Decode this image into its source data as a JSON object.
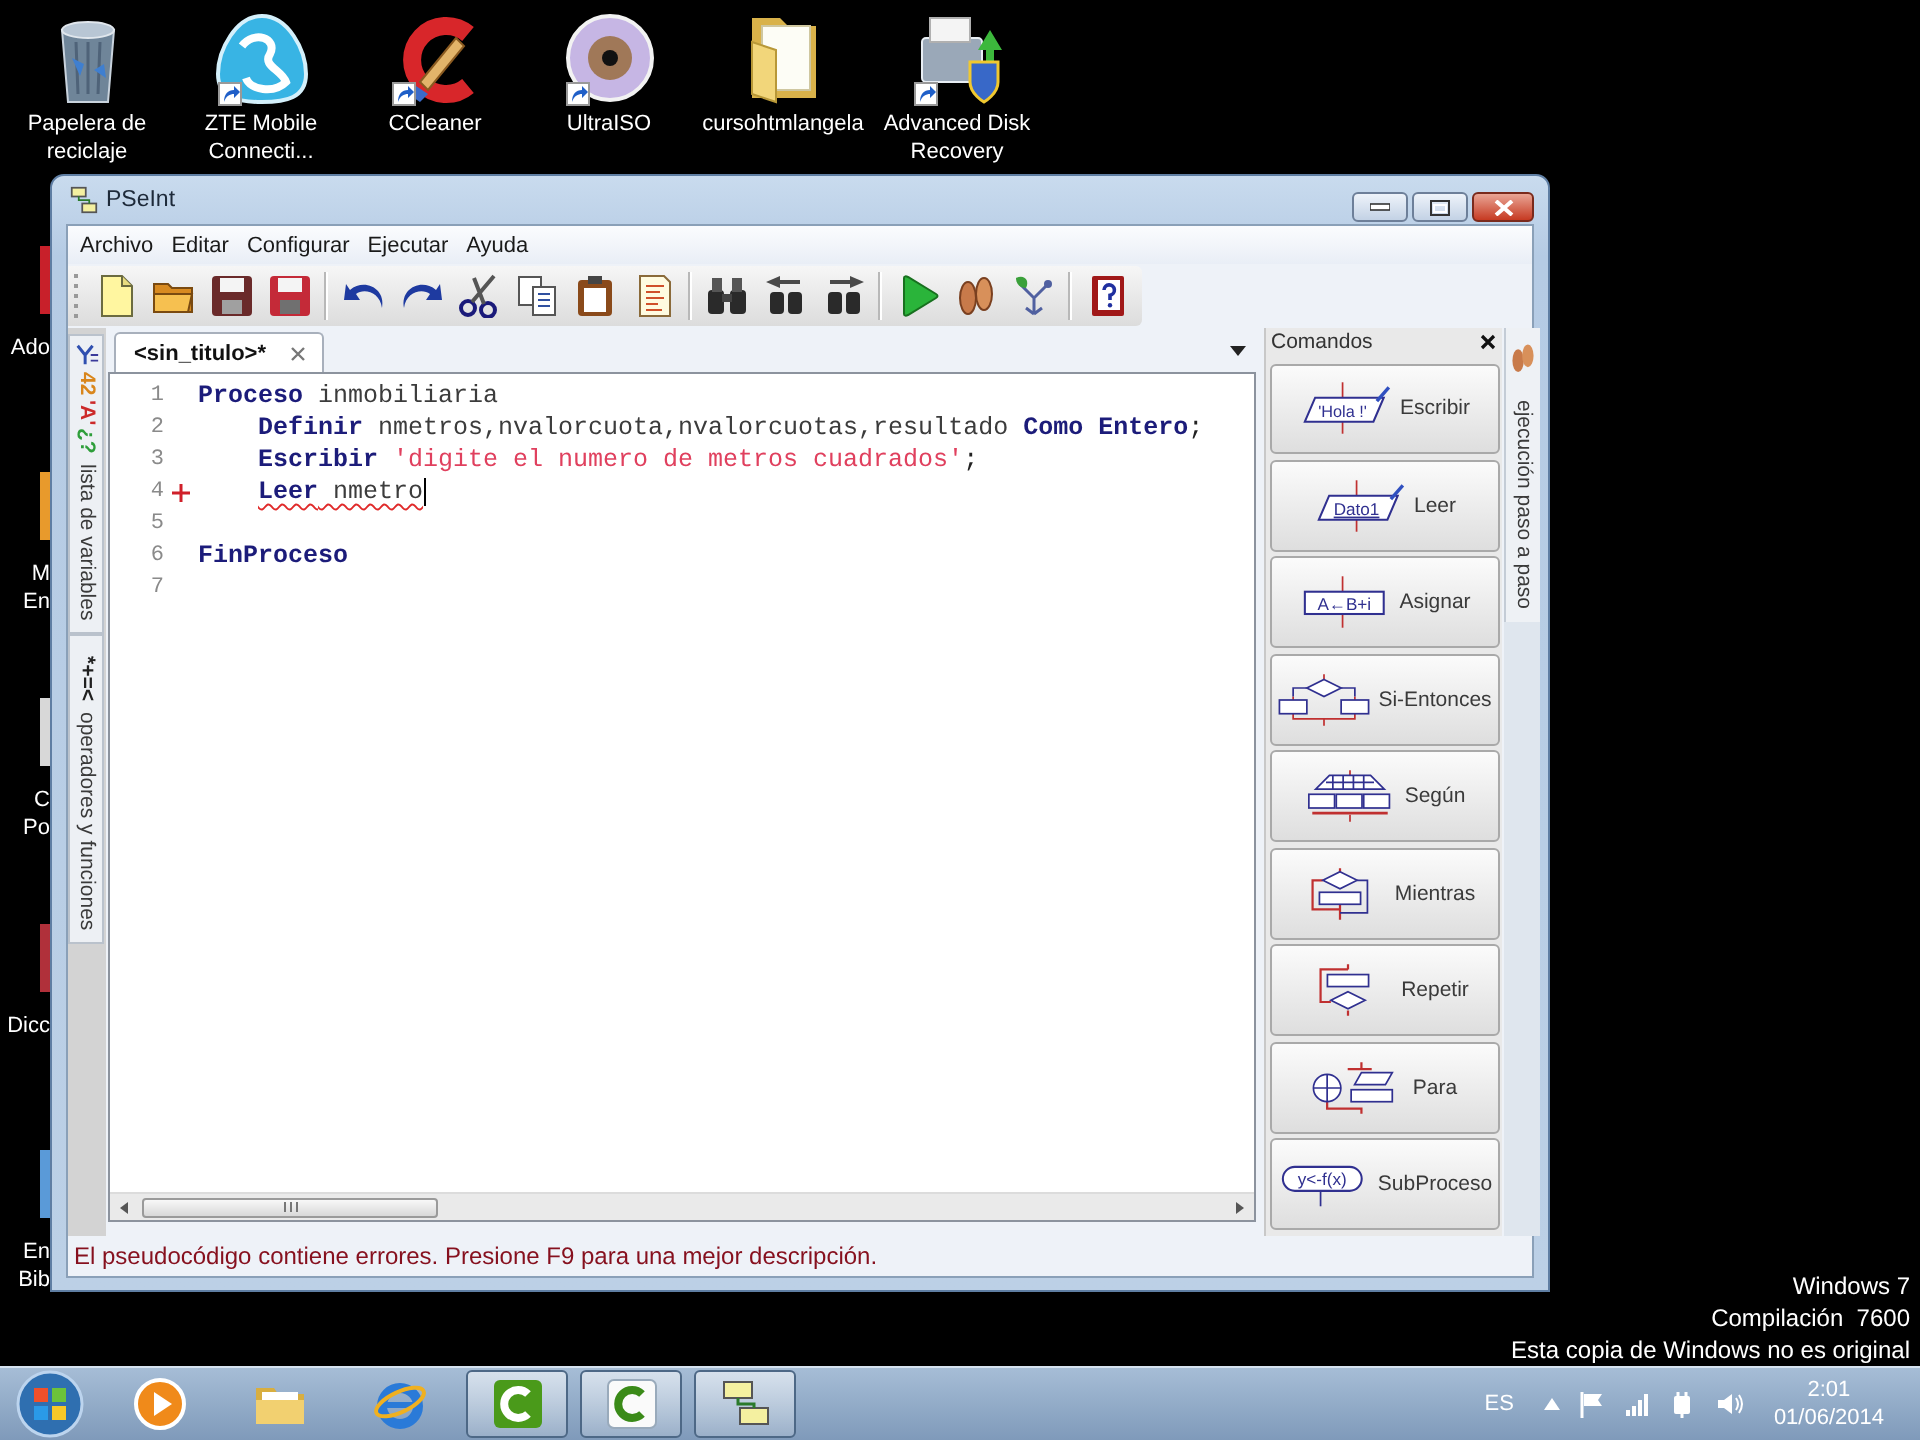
{
  "desktop_icons": [
    {
      "label": "Papelera de reciclaje",
      "shortcut": false
    },
    {
      "label": "ZTE Mobile Connecti...",
      "shortcut": true
    },
    {
      "label": "CCleaner",
      "shortcut": true
    },
    {
      "label": "UltraISO",
      "shortcut": true
    },
    {
      "label": "cursohtmlangela",
      "shortcut": false
    },
    {
      "label": "Advanced Disk Recovery",
      "shortcut": true
    }
  ],
  "desktop_edge_icons": [
    {
      "lines": [
        "Ado"
      ]
    },
    {
      "lines": [
        "M",
        "En"
      ]
    },
    {
      "lines": [
        "C",
        "Po"
      ]
    },
    {
      "lines": [
        "Dicc"
      ]
    },
    {
      "lines": [
        "En",
        "Bib"
      ]
    }
  ],
  "window": {
    "title": "PSeInt",
    "menu": [
      "Archivo",
      "Editar",
      "Configurar",
      "Ejecutar",
      "Ayuda"
    ],
    "side_tabs": [
      {
        "kind": "variables",
        "symbols": [
          {
            "text": "42",
            "color": "#d9861c"
          },
          {
            "text": "'A'",
            "color": "#cc2a2a"
          },
          {
            "text": "¿?",
            "color": "#2e9e3a"
          }
        ],
        "label": "lista de variables"
      },
      {
        "kind": "operators",
        "symbols": [
          {
            "text": "*+=<",
            "color": "#202020"
          }
        ],
        "label": "operadores y funciones"
      }
    ],
    "editor": {
      "tabs": [
        {
          "label": "<sin_titulo>*",
          "selected": true
        }
      ],
      "lines": [
        {
          "number": "1",
          "error": false,
          "caret": false,
          "tokens": [
            {
              "kind": "keyword",
              "text": "Proceso"
            },
            {
              "kind": "identifier",
              "text": " inmobiliaria"
            }
          ],
          "children": [
            {
              "number": "2",
              "error": false,
              "caret": false,
              "tokens": [
                {
                  "kind": "keyword",
                  "text": "Definir"
                },
                {
                  "kind": "identifier",
                  "text": " nmetros,nvalorcuota,nvalorcuotas,resultado "
                },
                {
                  "kind": "keyword",
                  "text": "Como Entero"
                },
                {
                  "kind": "punct",
                  "text": ";"
                }
              ]
            },
            {
              "number": "3",
              "error": false,
              "caret": false,
              "tokens": [
                {
                  "kind": "keyword",
                  "text": "Escribir"
                },
                {
                  "kind": "string",
                  "text": " 'digite el numero de metros cuadrados'"
                },
                {
                  "kind": "punct",
                  "text": ";"
                }
              ]
            },
            {
              "number": "4",
              "error": true,
              "caret": true,
              "tokens": [
                {
                  "kind": "keyword",
                  "text": "Leer"
                },
                {
                  "kind": "identifier",
                  "text": " nmetro"
                }
              ]
            }
          ]
        },
        {
          "number": "5",
          "error": false,
          "caret": false
        },
        {
          "number": "6",
          "error": false,
          "caret": false,
          "tokens": [
            {
              "kind": "keyword",
              "text": "FinProceso"
            }
          ]
        },
        {
          "number": "7",
          "error": false,
          "caret": false
        }
      ]
    },
    "commands": {
      "title": "Comandos",
      "items": [
        {
          "label": "Escribir",
          "kind": "escribir",
          "icon_text": "'Hola !'"
        },
        {
          "label": "Leer",
          "kind": "leer",
          "icon_text": "Dato1"
        },
        {
          "label": "Asignar",
          "kind": "asignar",
          "icon_text": "A←B+i"
        },
        {
          "label": "Si-Entonces",
          "kind": "si"
        },
        {
          "label": "Según",
          "kind": "segun"
        },
        {
          "label": "Mientras",
          "kind": "mientras"
        },
        {
          "label": "Repetir",
          "kind": "repetir"
        },
        {
          "label": "Para",
          "kind": "para"
        },
        {
          "label": "SubProceso",
          "kind": "subproceso",
          "icon_text": "y<-f(x)"
        }
      ]
    },
    "right_tab": {
      "label": "ejecución paso a paso"
    },
    "status": "El pseudocódigo contiene errores. Presione F9 para una mejor descripción."
  },
  "system_notice": [
    "Windows 7",
    "Compilación  7600",
    "Esta copia de Windows no es original"
  ],
  "taskbar": {
    "buttons": [
      {
        "running": false
      },
      {
        "running": false
      },
      {
        "running": false
      },
      {
        "running": true
      },
      {
        "running": true
      },
      {
        "running": true
      }
    ],
    "language": "ES",
    "clock": {
      "time": "2:01",
      "date": "01/06/2014"
    }
  }
}
